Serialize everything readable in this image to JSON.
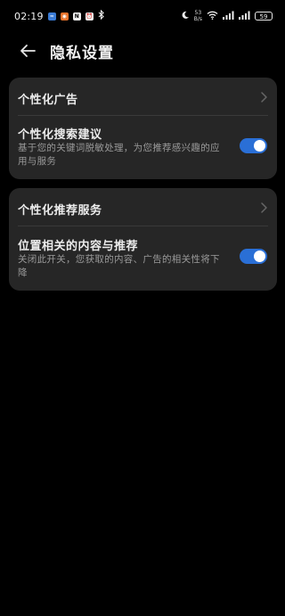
{
  "status_bar": {
    "time": "02:19",
    "net_speed_value": "53",
    "net_speed_unit": "B/s",
    "battery": "59"
  },
  "header": {
    "title": "隐私设置"
  },
  "section1": {
    "item1": {
      "title": "个性化广告"
    },
    "item2": {
      "title": "个性化搜索建议",
      "description": "基于您的关键词脱敏处理，为您推荐感兴趣的应用与服务",
      "toggle_on": true
    }
  },
  "section2": {
    "item1": {
      "title": "个性化推荐服务"
    },
    "item2": {
      "title": "位置相关的内容与推荐",
      "description": "关闭此开关，您获取的内容、广告的相关性将下降",
      "toggle_on": true
    }
  },
  "colors": {
    "background": "#000000",
    "card": "#262626",
    "toggle_accent": "#2a6fd6"
  }
}
